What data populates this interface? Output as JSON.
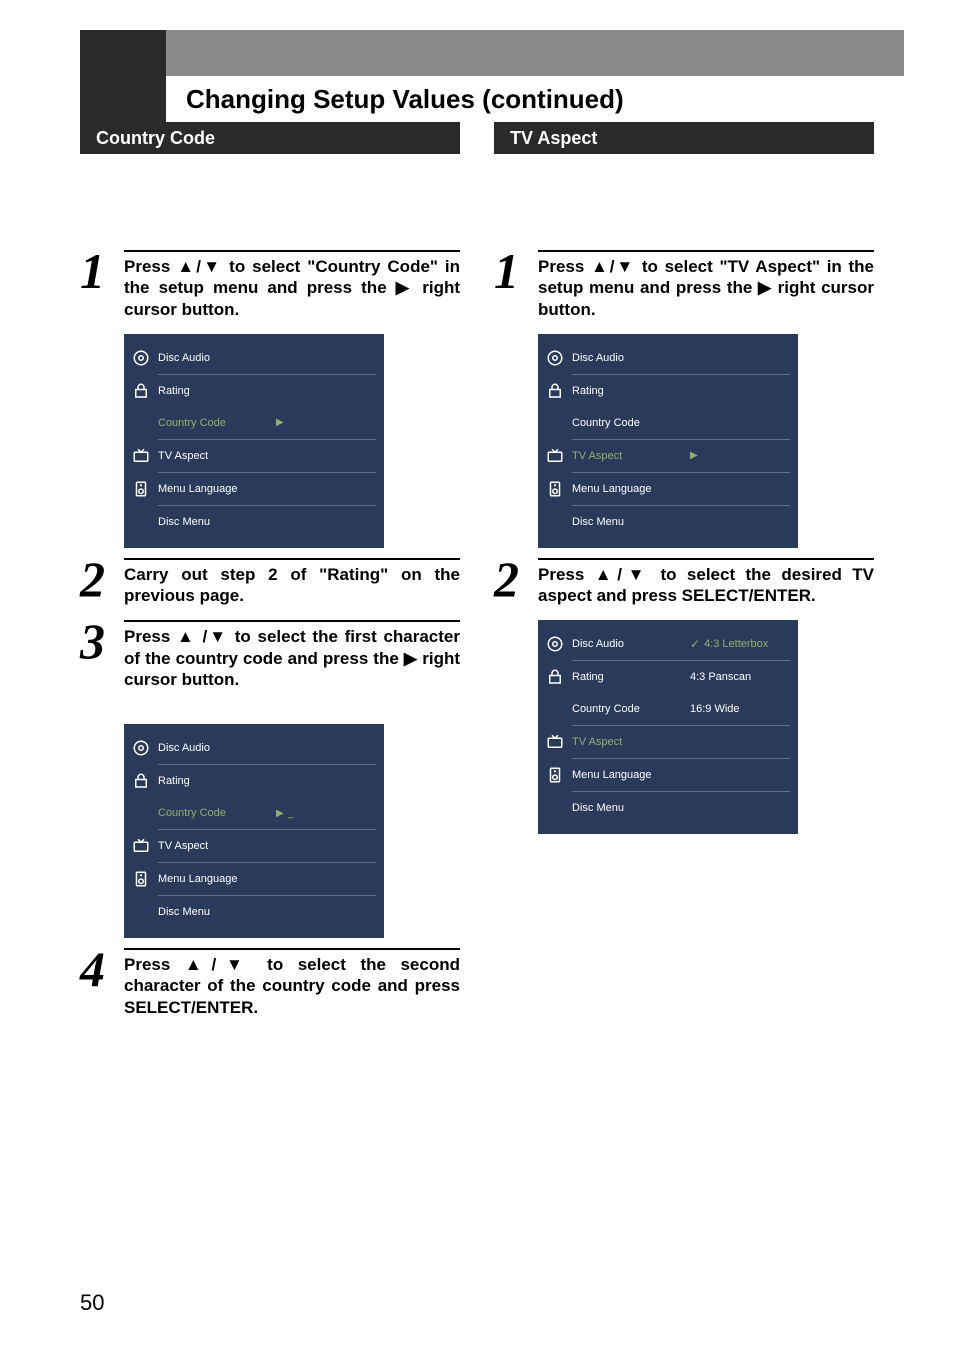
{
  "header": {
    "title": "Changing Setup Values (continued)"
  },
  "left": {
    "section_title": "Country Code",
    "step1": "Press ▲/▼ to select \"Country Code\" in the setup menu and press the ▶ right cursor button.",
    "step2": "Carry out step 2 of \"Rating\" on the previous page.",
    "step3": "Press ▲ /▼ to select the first character of the country code and press the ▶ right cursor button.",
    "step4": "Press ▲/▼ to select the second character of the country code and press SELECT/ENTER.",
    "menu1": {
      "rows": [
        {
          "label": "Disc Audio",
          "value": ""
        },
        {
          "label": "Rating",
          "value": ""
        },
        {
          "label": "Country Code",
          "value": "",
          "highlight": true,
          "arrow": true
        },
        {
          "label": "TV Aspect",
          "value": ""
        },
        {
          "label": "Menu Language",
          "value": ""
        },
        {
          "label": "Disc Menu",
          "value": ""
        }
      ]
    },
    "menu2": {
      "rows": [
        {
          "label": "Disc Audio",
          "value": ""
        },
        {
          "label": "Rating",
          "value": ""
        },
        {
          "label": "Country Code",
          "value": "",
          "highlight": true,
          "arrow": true,
          "suffix": "_"
        },
        {
          "label": "TV Aspect",
          "value": ""
        },
        {
          "label": "Menu Language",
          "value": ""
        },
        {
          "label": "Disc Menu",
          "value": ""
        }
      ]
    }
  },
  "right": {
    "section_title": "TV Aspect",
    "step1": "Press ▲/▼ to select \"TV Aspect\" in the setup menu and press the ▶ right cursor button.",
    "step2": "Press ▲/▼ to select the desired TV aspect and press SELECT/ENTER.",
    "menu1": {
      "rows": [
        {
          "label": "Disc Audio",
          "value": ""
        },
        {
          "label": "Rating",
          "value": ""
        },
        {
          "label": "Country Code",
          "value": ""
        },
        {
          "label": "TV Aspect",
          "value": "",
          "highlight": true,
          "arrow": true
        },
        {
          "label": "Menu Language",
          "value": ""
        },
        {
          "label": "Disc Menu",
          "value": ""
        }
      ]
    },
    "menu2": {
      "rows": [
        {
          "label": "Disc Audio",
          "value": "4:3 Letterbox",
          "vhl": true,
          "check": true
        },
        {
          "label": "Rating",
          "value": "4:3 Panscan"
        },
        {
          "label": "Country Code",
          "value": "16:9 Wide"
        },
        {
          "label": "TV Aspect",
          "value": "",
          "highlight": true
        },
        {
          "label": "Menu Language",
          "value": ""
        },
        {
          "label": "Disc Menu",
          "value": ""
        }
      ]
    }
  },
  "page_number": "50"
}
